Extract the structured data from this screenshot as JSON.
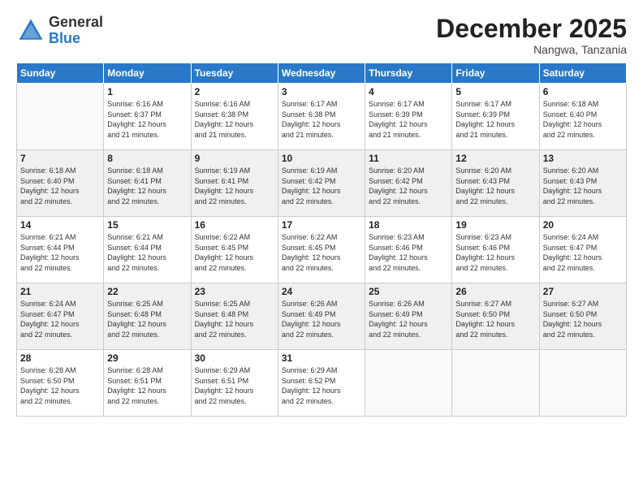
{
  "logo": {
    "general": "General",
    "blue": "Blue"
  },
  "title": "December 2025",
  "subtitle": "Nangwa, Tanzania",
  "days_of_week": [
    "Sunday",
    "Monday",
    "Tuesday",
    "Wednesday",
    "Thursday",
    "Friday",
    "Saturday"
  ],
  "weeks": [
    {
      "shaded": false,
      "days": [
        {
          "number": "",
          "info": ""
        },
        {
          "number": "1",
          "info": "Sunrise: 6:16 AM\nSunset: 6:37 PM\nDaylight: 12 hours\nand 21 minutes."
        },
        {
          "number": "2",
          "info": "Sunrise: 6:16 AM\nSunset: 6:38 PM\nDaylight: 12 hours\nand 21 minutes."
        },
        {
          "number": "3",
          "info": "Sunrise: 6:17 AM\nSunset: 6:38 PM\nDaylight: 12 hours\nand 21 minutes."
        },
        {
          "number": "4",
          "info": "Sunrise: 6:17 AM\nSunset: 6:39 PM\nDaylight: 12 hours\nand 21 minutes."
        },
        {
          "number": "5",
          "info": "Sunrise: 6:17 AM\nSunset: 6:39 PM\nDaylight: 12 hours\nand 21 minutes."
        },
        {
          "number": "6",
          "info": "Sunrise: 6:18 AM\nSunset: 6:40 PM\nDaylight: 12 hours\nand 22 minutes."
        }
      ]
    },
    {
      "shaded": true,
      "days": [
        {
          "number": "7",
          "info": "Sunrise: 6:18 AM\nSunset: 6:40 PM\nDaylight: 12 hours\nand 22 minutes."
        },
        {
          "number": "8",
          "info": "Sunrise: 6:18 AM\nSunset: 6:41 PM\nDaylight: 12 hours\nand 22 minutes."
        },
        {
          "number": "9",
          "info": "Sunrise: 6:19 AM\nSunset: 6:41 PM\nDaylight: 12 hours\nand 22 minutes."
        },
        {
          "number": "10",
          "info": "Sunrise: 6:19 AM\nSunset: 6:42 PM\nDaylight: 12 hours\nand 22 minutes."
        },
        {
          "number": "11",
          "info": "Sunrise: 6:20 AM\nSunset: 6:42 PM\nDaylight: 12 hours\nand 22 minutes."
        },
        {
          "number": "12",
          "info": "Sunrise: 6:20 AM\nSunset: 6:43 PM\nDaylight: 12 hours\nand 22 minutes."
        },
        {
          "number": "13",
          "info": "Sunrise: 6:20 AM\nSunset: 6:43 PM\nDaylight: 12 hours\nand 22 minutes."
        }
      ]
    },
    {
      "shaded": false,
      "days": [
        {
          "number": "14",
          "info": "Sunrise: 6:21 AM\nSunset: 6:44 PM\nDaylight: 12 hours\nand 22 minutes."
        },
        {
          "number": "15",
          "info": "Sunrise: 6:21 AM\nSunset: 6:44 PM\nDaylight: 12 hours\nand 22 minutes."
        },
        {
          "number": "16",
          "info": "Sunrise: 6:22 AM\nSunset: 6:45 PM\nDaylight: 12 hours\nand 22 minutes."
        },
        {
          "number": "17",
          "info": "Sunrise: 6:22 AM\nSunset: 6:45 PM\nDaylight: 12 hours\nand 22 minutes."
        },
        {
          "number": "18",
          "info": "Sunrise: 6:23 AM\nSunset: 6:46 PM\nDaylight: 12 hours\nand 22 minutes."
        },
        {
          "number": "19",
          "info": "Sunrise: 6:23 AM\nSunset: 6:46 PM\nDaylight: 12 hours\nand 22 minutes."
        },
        {
          "number": "20",
          "info": "Sunrise: 6:24 AM\nSunset: 6:47 PM\nDaylight: 12 hours\nand 22 minutes."
        }
      ]
    },
    {
      "shaded": true,
      "days": [
        {
          "number": "21",
          "info": "Sunrise: 6:24 AM\nSunset: 6:47 PM\nDaylight: 12 hours\nand 22 minutes."
        },
        {
          "number": "22",
          "info": "Sunrise: 6:25 AM\nSunset: 6:48 PM\nDaylight: 12 hours\nand 22 minutes."
        },
        {
          "number": "23",
          "info": "Sunrise: 6:25 AM\nSunset: 6:48 PM\nDaylight: 12 hours\nand 22 minutes."
        },
        {
          "number": "24",
          "info": "Sunrise: 6:26 AM\nSunset: 6:49 PM\nDaylight: 12 hours\nand 22 minutes."
        },
        {
          "number": "25",
          "info": "Sunrise: 6:26 AM\nSunset: 6:49 PM\nDaylight: 12 hours\nand 22 minutes."
        },
        {
          "number": "26",
          "info": "Sunrise: 6:27 AM\nSunset: 6:50 PM\nDaylight: 12 hours\nand 22 minutes."
        },
        {
          "number": "27",
          "info": "Sunrise: 6:27 AM\nSunset: 6:50 PM\nDaylight: 12 hours\nand 22 minutes."
        }
      ]
    },
    {
      "shaded": false,
      "days": [
        {
          "number": "28",
          "info": "Sunrise: 6:28 AM\nSunset: 6:50 PM\nDaylight: 12 hours\nand 22 minutes."
        },
        {
          "number": "29",
          "info": "Sunrise: 6:28 AM\nSunset: 6:51 PM\nDaylight: 12 hours\nand 22 minutes."
        },
        {
          "number": "30",
          "info": "Sunrise: 6:29 AM\nSunset: 6:51 PM\nDaylight: 12 hours\nand 22 minutes."
        },
        {
          "number": "31",
          "info": "Sunrise: 6:29 AM\nSunset: 6:52 PM\nDaylight: 12 hours\nand 22 minutes."
        },
        {
          "number": "",
          "info": ""
        },
        {
          "number": "",
          "info": ""
        },
        {
          "number": "",
          "info": ""
        }
      ]
    }
  ]
}
